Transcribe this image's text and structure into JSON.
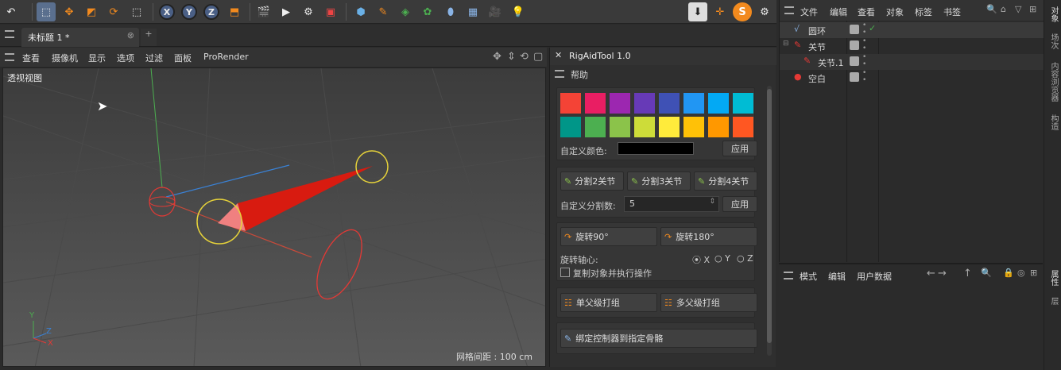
{
  "top_toolbar": {
    "axis_x": "X",
    "axis_y": "Y",
    "axis_z": "Z"
  },
  "tabs": {
    "doc_title": "未标题 1 *",
    "add": "+"
  },
  "viewport_menu": {
    "items": [
      "查看",
      "摄像机",
      "显示",
      "选项",
      "过滤",
      "面板",
      "ProRender"
    ]
  },
  "viewport": {
    "label": "透视视图",
    "grid_text": "网格间距 : 100 cm",
    "axis_y": "Y",
    "axis_z": "Z",
    "axis_x": "X"
  },
  "rig_panel": {
    "title": "RigAidTool 1.0",
    "help": "帮助",
    "colors_row1": [
      "#f44336",
      "#e91e63",
      "#9c27b0",
      "#673ab7",
      "#3f51b5",
      "#2196f3",
      "#03a9f4",
      "#00bcd4"
    ],
    "colors_row2": [
      "#009688",
      "#4caf50",
      "#8bc34a",
      "#cddc39",
      "#ffeb3b",
      "#ffc107",
      "#ff9800",
      "#ff5722"
    ],
    "custom_color_label": "自定义颜色:",
    "apply": "应用",
    "split2": "分割2关节",
    "split3": "分割3关节",
    "split4": "分割4关节",
    "custom_split_label": "自定义分割数:",
    "custom_split_value": "5",
    "apply2": "应用",
    "rotate90": "旋转90°",
    "rotate180": "旋转180°",
    "rotate_axis_label": "旋转轴心:",
    "axis_opts": [
      "X",
      "Y",
      "Z"
    ],
    "copy_label": "复制对象并执行操作",
    "single_group": "单父级打组",
    "multi_group": "多父级打组",
    "bind_controller": "绑定控制器到指定骨骼"
  },
  "object_manager": {
    "menu": [
      "文件",
      "编辑",
      "查看",
      "对象",
      "标签",
      "书签"
    ],
    "objects": [
      {
        "name": "圆环",
        "indent": 0
      },
      {
        "name": "关节",
        "indent": 0
      },
      {
        "name": "关节.1",
        "indent": 1
      },
      {
        "name": "空白",
        "indent": 0
      }
    ]
  },
  "attributes": {
    "menu": [
      "模式",
      "编辑",
      "用户数据"
    ]
  },
  "side_tabs": [
    "对象",
    "场次",
    "内容浏览器",
    "构造",
    "属性",
    "层"
  ]
}
